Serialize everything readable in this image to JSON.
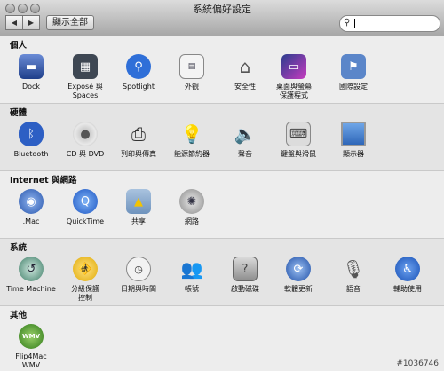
{
  "window": {
    "title": "系統偏好設定"
  },
  "toolbar": {
    "back": "◀",
    "forward": "▶",
    "show_all": "顯示全部",
    "search_icon": "magnifier-icon"
  },
  "sections": [
    {
      "title": "個人",
      "items": [
        {
          "label": "Dock",
          "icon": "dock-icon"
        },
        {
          "label": "Exposé 與\nSpaces",
          "icon": "expose-spaces-icon"
        },
        {
          "label": "Spotlight",
          "icon": "spotlight-icon"
        },
        {
          "label": "外觀",
          "icon": "appearance-icon"
        },
        {
          "label": "安全性",
          "icon": "security-icon"
        },
        {
          "label": "桌面與螢幕\n保護程式",
          "icon": "desktop-screensaver-icon"
        },
        {
          "label": "國際設定",
          "icon": "international-icon"
        }
      ]
    },
    {
      "title": "硬體",
      "items": [
        {
          "label": "Bluetooth",
          "icon": "bluetooth-icon"
        },
        {
          "label": "CD 與 DVD",
          "icon": "cd-dvd-icon"
        },
        {
          "label": "列印與傳真",
          "icon": "print-fax-icon"
        },
        {
          "label": "能源節約器",
          "icon": "energy-saver-icon"
        },
        {
          "label": "聲音",
          "icon": "sound-icon"
        },
        {
          "label": "鍵盤與滑鼠",
          "icon": "keyboard-mouse-icon"
        },
        {
          "label": "顯示器",
          "icon": "displays-icon"
        }
      ]
    },
    {
      "title": "Internet 與網路",
      "items": [
        {
          "label": ".Mac",
          "icon": "dotmac-icon"
        },
        {
          "label": "QuickTime",
          "icon": "quicktime-icon"
        },
        {
          "label": "共享",
          "icon": "sharing-icon"
        },
        {
          "label": "網路",
          "icon": "network-icon"
        }
      ]
    },
    {
      "title": "系統",
      "items": [
        {
          "label": "Time Machine",
          "icon": "time-machine-icon"
        },
        {
          "label": "分級保護\n控制",
          "icon": "parental-controls-icon"
        },
        {
          "label": "日期與時間",
          "icon": "date-time-icon"
        },
        {
          "label": "帳號",
          "icon": "accounts-icon"
        },
        {
          "label": "啟動磁碟",
          "icon": "startup-disk-icon"
        },
        {
          "label": "軟體更新",
          "icon": "software-update-icon"
        },
        {
          "label": "語音",
          "icon": "speech-icon"
        },
        {
          "label": "輔助使用",
          "icon": "universal-access-icon"
        }
      ]
    },
    {
      "title": "其他",
      "items": [
        {
          "label": "Flip4Mac\nWMV",
          "icon": "flip4mac-wmv-icon"
        }
      ]
    }
  ],
  "watermark": "#1036746"
}
